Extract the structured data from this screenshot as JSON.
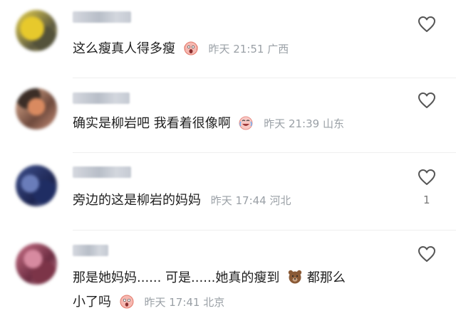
{
  "comments": [
    {
      "text": "这么瘦真人得多瘦",
      "emoji": "scream-emoji",
      "time": "昨天 21:51 广西",
      "like_count": ""
    },
    {
      "text": "确实是柳岩吧 我看着很像啊",
      "emoji": "laughing-crying-emoji",
      "time": "昨天 21:39 山东",
      "like_count": ""
    },
    {
      "text": "旁边的这是柳岩的妈妈",
      "emoji": "",
      "time": "昨天 17:44 河北",
      "like_count": "1"
    },
    {
      "text_line1": "那是她妈妈...... 可是......她真的瘦到",
      "emoji_inline": "bear-emoji",
      "text_line1_after": "都那么",
      "text_line2": "小了吗",
      "emoji": "shocked-emoji",
      "time": "昨天 17:41 北京",
      "like_count": ""
    }
  ]
}
